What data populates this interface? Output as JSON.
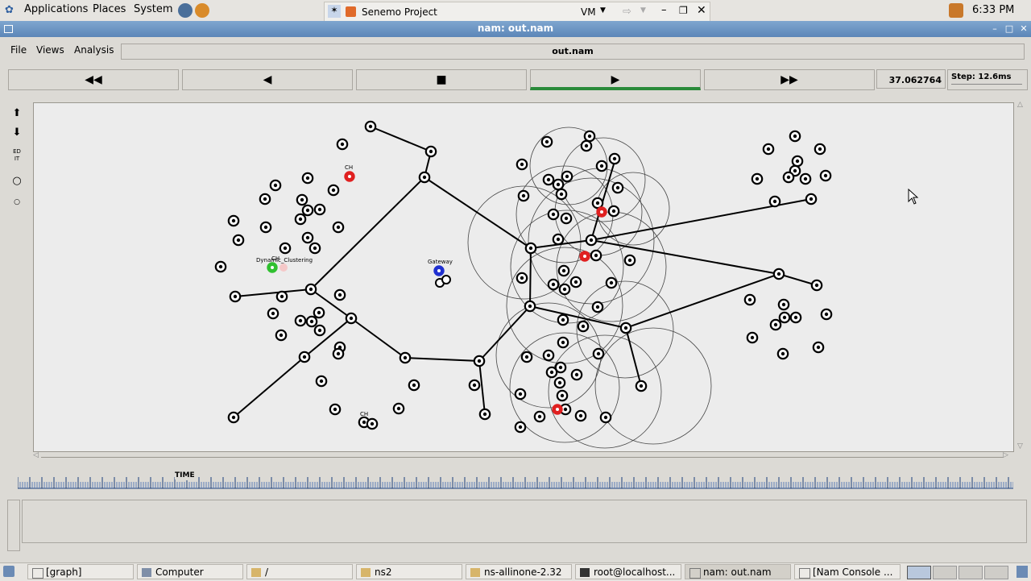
{
  "top_panel": {
    "menus": [
      "Applications",
      "Places",
      "System"
    ],
    "clock": "6:33 PM",
    "window_button": {
      "label": "Senemo Project",
      "vm_label": "VM"
    }
  },
  "window": {
    "title": "nam: out.nam"
  },
  "menubar": {
    "items": [
      "File",
      "Views",
      "Analysis"
    ],
    "file_name": "out.nam"
  },
  "controls": {
    "rewind": "◀◀",
    "back": "◀",
    "stop": "■",
    "play": "▶",
    "fast_forward": "▶▶",
    "time": "37.062764",
    "step": "Step: 12.6ms"
  },
  "tools": {
    "edit_label": "EDIT"
  },
  "canvas_labels": {
    "ch1": "CH",
    "ch2": "CH",
    "ch3": "CH",
    "dynamic": "Dynamic_Clustering",
    "gateway": "Gateway"
  },
  "timeline": {
    "label": "TIME"
  },
  "taskbar": {
    "tasks": [
      "[graph]",
      "Computer",
      "/",
      "ns2",
      "ns-allinone-2.32",
      "root@localhost...",
      "nam: out.nam",
      "[Nam Console ..."
    ]
  },
  "colors": {
    "titlebar": "#5b86b8",
    "cluster_head": "#e02020",
    "gateway": "#2030d0",
    "dynamic_node": "#30c030",
    "play_progress": "#2a8a3a"
  }
}
